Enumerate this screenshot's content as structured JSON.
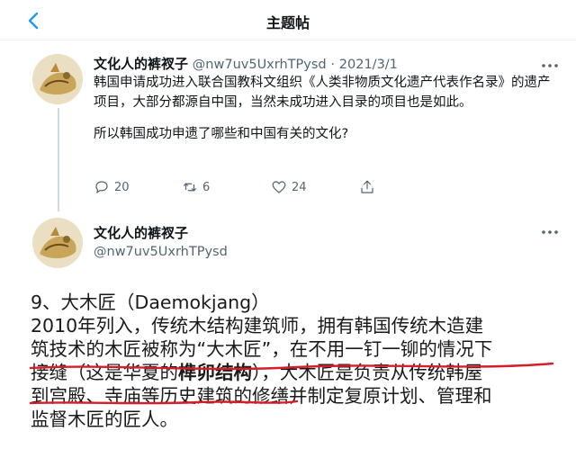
{
  "header": {
    "title": "主题帖"
  },
  "icons": {
    "back": "chevron-left-icon",
    "more": "more-horizontal-icon",
    "reply": "reply-icon",
    "retweet": "retweet-icon",
    "like": "heart-icon",
    "share": "share-icon"
  },
  "colors": {
    "accent": "#1d9bf0",
    "annotation_red": "#d41e2a"
  },
  "tweet1": {
    "author_name": "文化人的裤衩子",
    "handle": "@nw7uv5UxrhTPysd",
    "separator": "·",
    "date": "2021/3/1",
    "paragraph1": "韩国申请成功进入联合国教科文组织《人类非物质文化遗产代表作名录》的遗产项目，大部分都源自中国，当然未成功进入目录的项目也是如此。",
    "paragraph2": "所以韩国成功申遗了哪些和中国有关的文化?",
    "replies": "20",
    "retweets": "6",
    "likes": "24"
  },
  "tweet2": {
    "author_name": "文化人的裤衩子",
    "handle": "@nw7uv5UxrhTPysd"
  },
  "article": {
    "line1": "9、大木匠（Daemokjang）",
    "line2": "2010年列入，传统木结构建筑师，拥有韩国传统木造建",
    "line3": "筑技术的木匠被称为“大木匠”，在不用一钉一铆的情况下",
    "line4_prefix": "接缝（这是华夏的",
    "line4_bold": "榫卯结构",
    "line4_suffix": "），大木匠是负责从传统韩屋",
    "line5": "到宫殿、寺庙等历史建筑的修缮并制定复原计划、管理和",
    "line6": "监督木匠的匠人。"
  }
}
